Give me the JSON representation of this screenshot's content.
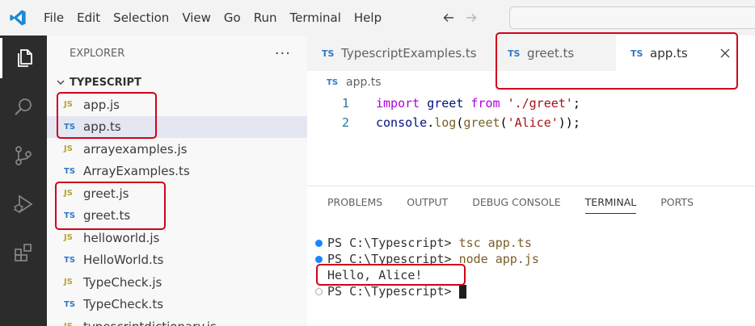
{
  "menu": {
    "items": [
      "File",
      "Edit",
      "Selection",
      "View",
      "Go",
      "Run",
      "Terminal",
      "Help"
    ]
  },
  "explorer": {
    "title": "EXPLORER",
    "more_label": "···",
    "folder": "TYPESCRIPT",
    "files": [
      {
        "icon": "JS",
        "name": "app.js"
      },
      {
        "icon": "TS",
        "name": "app.ts"
      },
      {
        "icon": "JS",
        "name": "arrayexamples.js"
      },
      {
        "icon": "TS",
        "name": "ArrayExamples.ts"
      },
      {
        "icon": "JS",
        "name": "greet.js"
      },
      {
        "icon": "TS",
        "name": "greet.ts"
      },
      {
        "icon": "JS",
        "name": "helloworld.js"
      },
      {
        "icon": "TS",
        "name": "HelloWorld.ts"
      },
      {
        "icon": "JS",
        "name": "TypeCheck.js"
      },
      {
        "icon": "TS",
        "name": "TypeCheck.ts"
      },
      {
        "icon": "JS",
        "name": "typescriptdictionary.js"
      }
    ]
  },
  "tabs": [
    {
      "icon": "TS",
      "label": "TypescriptExamples.ts"
    },
    {
      "icon": "TS",
      "label": "greet.ts"
    },
    {
      "icon": "TS",
      "label": "app.ts"
    }
  ],
  "editor": {
    "breadcrumb_icon": "TS",
    "breadcrumb": "app.ts",
    "lines": [
      {
        "num": "1",
        "t1": "import",
        "t2": " greet ",
        "t3": "from",
        "t4": " ",
        "t5": "'./greet'",
        "t6": ";"
      },
      {
        "num": "2",
        "t1": "console",
        "t2": ".",
        "t3": "log",
        "t4": "(",
        "t5": "greet",
        "t6": "(",
        "t7": "'Alice'",
        "t8": "));"
      }
    ]
  },
  "panel": {
    "tabs": [
      "PROBLEMS",
      "OUTPUT",
      "DEBUG CONSOLE",
      "TERMINAL",
      "PORTS"
    ],
    "active_tab": "TERMINAL"
  },
  "terminal": {
    "lines": [
      {
        "prompt": "PS C:\\Typescript> ",
        "cmd": "tsc app.ts"
      },
      {
        "prompt": "PS C:\\Typescript> ",
        "cmd": "node app.js"
      },
      {
        "output": "Hello, Alice!"
      },
      {
        "prompt": "PS C:\\Typescript> "
      }
    ]
  },
  "colors": {
    "highlight": "#d0021b",
    "activity_bar": "#2c2c2c",
    "ts_icon": "#3178c6",
    "js_icon": "#b8a233"
  }
}
